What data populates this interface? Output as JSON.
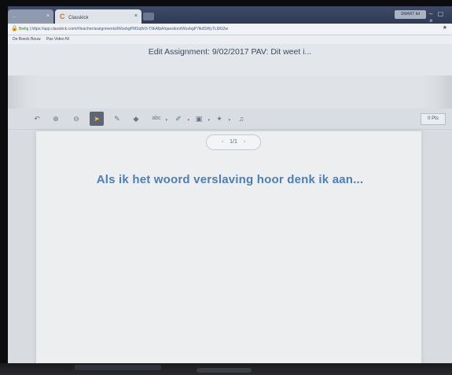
{
  "browser": {
    "tabs": [
      {
        "label": "...",
        "active": false
      },
      {
        "label": "Classkick",
        "active": true
      }
    ],
    "profile_badge": "SMART bd",
    "address": {
      "secure_label": "Beilig",
      "url": "https://app.classkick.com/#/teacher/assignments/...",
      "url_display": "https://app.classkick.com/#/teacher/assignments/iWzebgPMSqWJi-T0kAfpA/question/iWzebgP7lkdSWyTLt9G2w"
    },
    "bookmarks": [
      {
        "label": "De Boeck Bouw"
      },
      {
        "label": "Pas Video NI"
      }
    ]
  },
  "assignment": {
    "title": "Edit Assignment: 9/02/2017 PAV: Dit weet i..."
  },
  "toolbar": {
    "tools": [
      {
        "icon": "undo-icon",
        "glyph": "↶"
      },
      {
        "icon": "zoom-in-icon",
        "glyph": "⊕"
      },
      {
        "icon": "zoom-out-icon",
        "glyph": "⊖"
      },
      {
        "icon": "pointer-icon",
        "glyph": "➤",
        "selected": true
      },
      {
        "icon": "pen-icon",
        "glyph": "✎"
      },
      {
        "icon": "eraser-icon",
        "glyph": "◆"
      },
      {
        "icon": "text-icon",
        "glyph": "abc"
      },
      {
        "icon": "highlighter-icon",
        "glyph": "✐"
      },
      {
        "icon": "image-icon",
        "glyph": "▣"
      },
      {
        "icon": "sticker-icon",
        "glyph": "✦"
      },
      {
        "icon": "audio-icon",
        "glyph": "♫"
      }
    ],
    "points": "0 Pts"
  },
  "page": {
    "pager_label": "1/1",
    "question_text": "Als ik het woord verslaving hoor denk ik aan..."
  },
  "colors": {
    "accent": "#4d7fb4",
    "selected_tool_bg": "#5d6672",
    "selected_tool_icon": "#f4c04a",
    "logo": "#e06a2a"
  }
}
